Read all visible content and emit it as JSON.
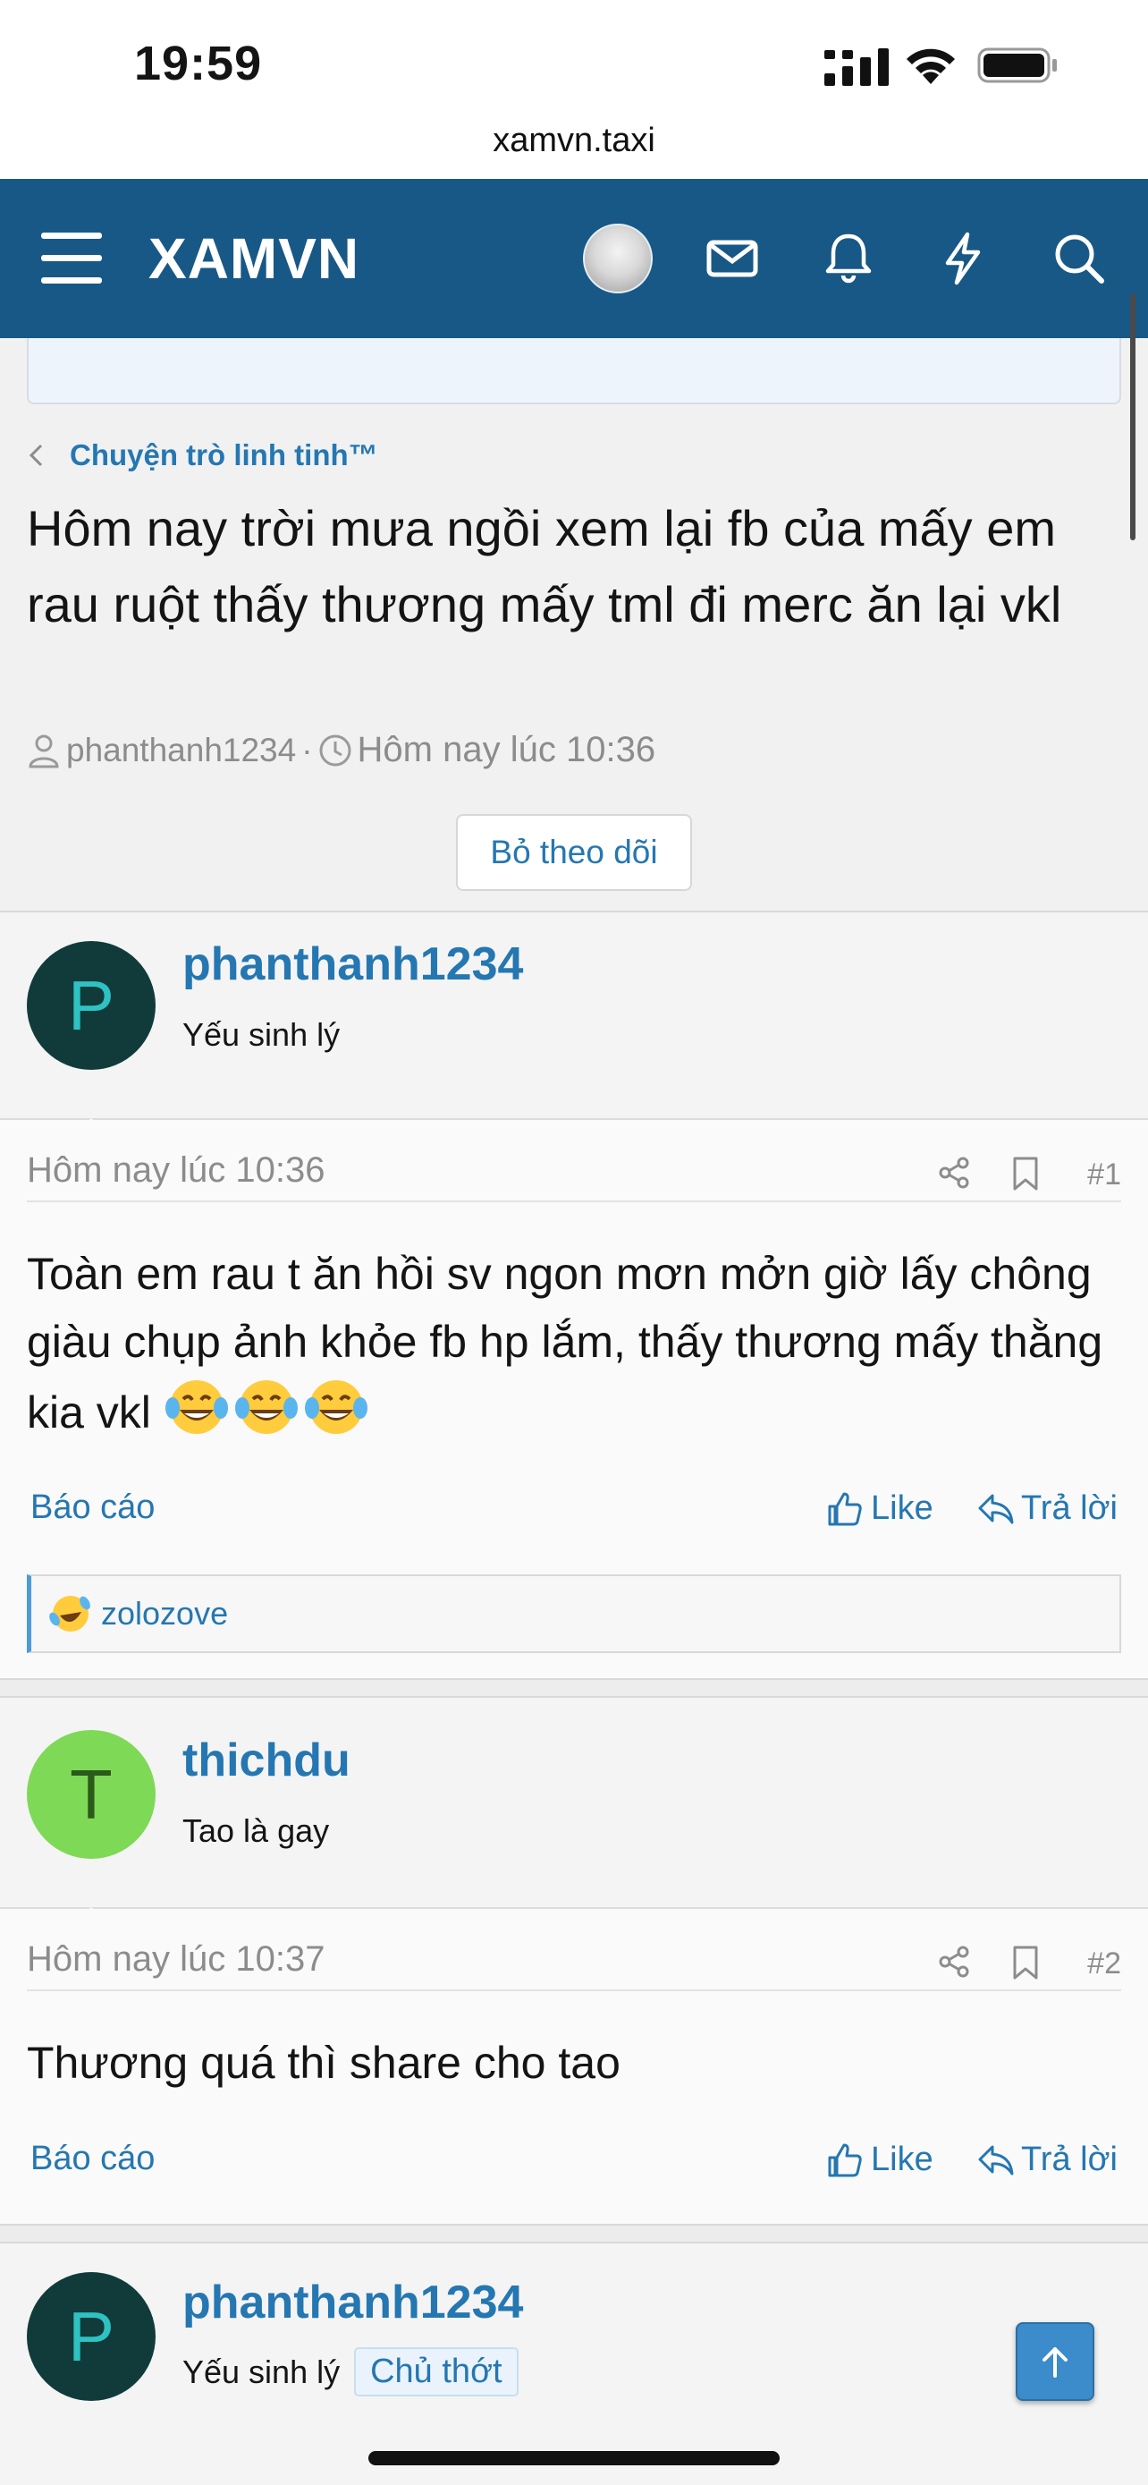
{
  "status_bar": {
    "time": "19:59",
    "url": "xamvn.taxi"
  },
  "header": {
    "logo": "XAMVN",
    "icons": [
      "menu-icon",
      "avatar",
      "mail-icon",
      "bell-icon",
      "lightning-icon",
      "search-icon"
    ]
  },
  "breadcrumb": {
    "label": "Chuyện trò linh tinh™"
  },
  "thread": {
    "title": "Hôm nay trời mưa ngồi xem lại fb của mấy em rau ruột thấy thương mấy tml đi merc ăn lại vkl",
    "author": "phanthanh1234",
    "separator": "·",
    "date": "Hôm nay lúc 10:36",
    "unwatch_label": "Bỏ theo dõi"
  },
  "posts": [
    {
      "avatar_letter": "P",
      "avatar_bg": "#113b3b",
      "avatar_fg": "#2ec2c2",
      "username": "phanthanh1234",
      "user_title": "Yếu sinh lý",
      "date": "Hôm nay lúc 10:36",
      "number": "#1",
      "text": "Toàn em rau t ăn hồi sv ngon mơn mởn giờ lấy chông giàu chụp ảnh khỏe fb hp lắm, thấy thương mấy thằng kia vkl",
      "emojis": [
        "tears-of-joy-emoji",
        "tears-of-joy-emoji",
        "tears-of-joy-emoji"
      ],
      "report_label": "Báo cáo",
      "like_label": "Like",
      "reply_label": "Trả lời",
      "reaction_user": "zolozove"
    },
    {
      "avatar_letter": "T",
      "avatar_bg": "#7ed957",
      "avatar_fg": "#2c5a1a",
      "username": "thichdu",
      "user_title": "Tao là gay",
      "date": "Hôm nay lúc 10:37",
      "number": "#2",
      "text": "Thương quá thì share cho tao",
      "report_label": "Báo cáo",
      "like_label": "Like",
      "reply_label": "Trả lời"
    },
    {
      "avatar_letter": "P",
      "avatar_bg": "#113b3b",
      "avatar_fg": "#2ec2c2",
      "username": "phanthanh1234",
      "user_title": "Yếu sinh lý",
      "badge": "Chủ thớt"
    }
  ],
  "colors": {
    "header_bg": "#185886",
    "link": "#2577b1",
    "muted": "#8c8c8c"
  }
}
